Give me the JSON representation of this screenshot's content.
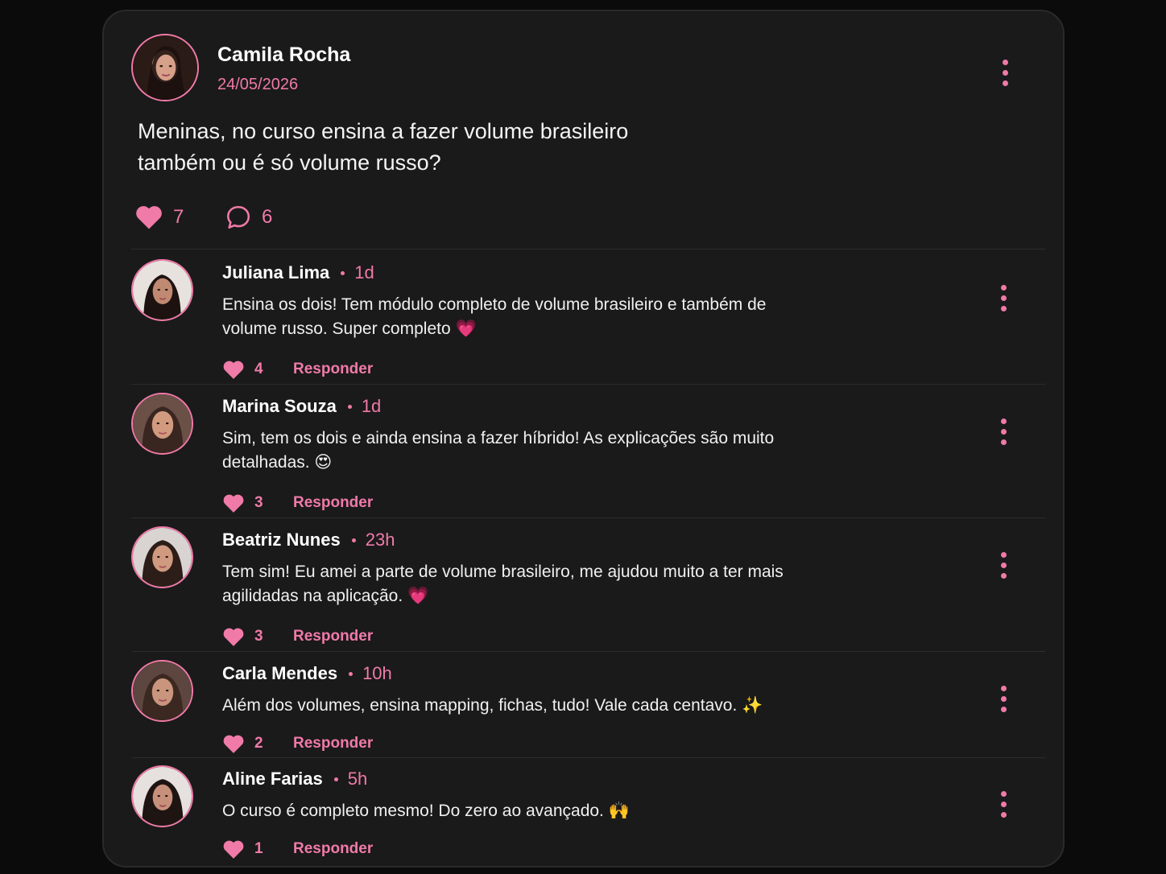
{
  "post": {
    "author": "Camila Rocha",
    "date": "24/05/2026",
    "text": "Meninas, no curso ensina a fazer volume brasileiro também ou é só volume russo?",
    "likes": "7",
    "comments": "6"
  },
  "comments": [
    {
      "name": "Juliana Lima",
      "time": "1d",
      "text": "Ensina os dois! Tem módulo completo de volume brasileiro e também de volume russo. Super completo 💗",
      "likes": "4",
      "reply_label": "Responder"
    },
    {
      "name": "Marina Souza",
      "time": "1d",
      "text": "Sim, tem os dois e ainda ensina a fazer híbrido! As explicações são muito detalhadas. 😍",
      "likes": "3",
      "reply_label": "Responder"
    },
    {
      "name": "Beatriz Nunes",
      "time": "23h",
      "text": "Tem sim! Eu amei a parte de volume brasileiro, me ajudou muito a ter mais agilidadas na aplicação. 💗",
      "likes": "3",
      "reply_label": "Responder"
    },
    {
      "name": "Carla Mendes",
      "time": "10h",
      "text": "Além dos volumes, ensina mapping, fichas, tudo! Vale cada centavo. ✨",
      "likes": "2",
      "reply_label": "Responder"
    },
    {
      "name": "Aline Farias",
      "time": "5h",
      "text": "O curso é completo mesmo! Do zero ao avançado. 🙌",
      "likes": "1",
      "reply_label": "Responder"
    }
  ],
  "colors": {
    "accent": "#f07aa8",
    "background": "#0b0b0b",
    "card": "#1a1a1a"
  },
  "icons": [
    "heart-icon",
    "comment-bubble-icon",
    "more-vertical-icon",
    "avatar-photo"
  ]
}
